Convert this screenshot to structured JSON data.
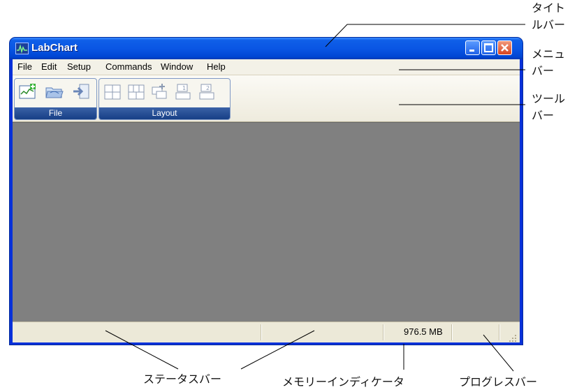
{
  "window": {
    "title": "LabChart",
    "menu": [
      "File",
      "Edit",
      "Setup",
      "Commands",
      "Window",
      "Help"
    ],
    "toolbar_groups": [
      {
        "label": "File",
        "buttons": [
          "new-chart-icon",
          "open-folder-icon",
          "import-icon"
        ]
      },
      {
        "label": "Layout",
        "buttons": [
          "grid-four-icon",
          "grid-three-icon",
          "window-add-icon",
          "window-one-icon",
          "window-two-icon"
        ]
      }
    ],
    "status": {
      "memory": "976.5 MB"
    }
  },
  "annotations": {
    "title_bar": [
      "タイト",
      "ルバー"
    ],
    "menu_bar": [
      "メニュ",
      "バー"
    ],
    "toolbar": [
      "ツール",
      "バー"
    ],
    "status_bar": "ステータスバー",
    "memory_indicator": "メモリーインディケータ",
    "progress_bar": "プログレスバー"
  },
  "colors": {
    "titlebar": "#0a56e4",
    "workspace": "#808080",
    "toolbar_label_bg": "#163f86"
  }
}
